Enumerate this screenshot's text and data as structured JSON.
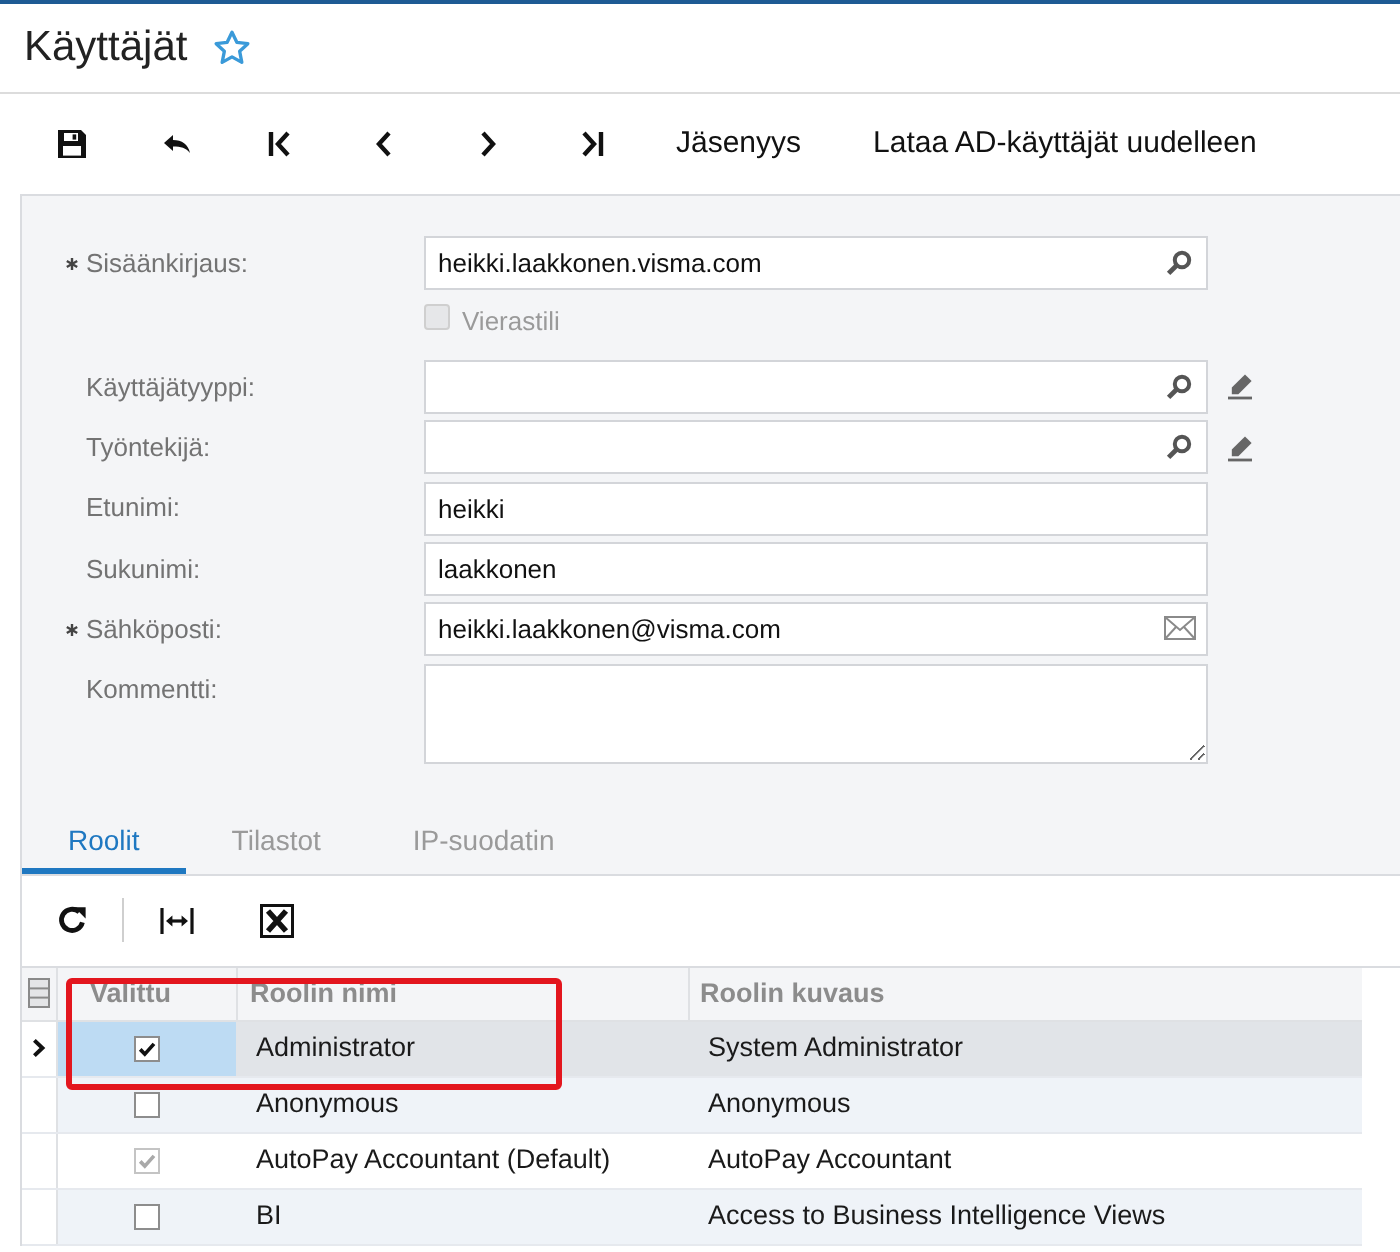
{
  "page": {
    "title": "Käyttäjät",
    "favorite": false
  },
  "toolbar": {
    "text_buttons": [
      "Jäsenyys",
      "Lataa AD-käyttäjät uudelleen"
    ]
  },
  "form": {
    "fields": [
      {
        "kind": "lookup",
        "label": "Sisäänkirjaus:",
        "value": "heikki.laakkonen.visma.com",
        "required": true
      },
      {
        "kind": "checkbox",
        "label": "Vierastili",
        "checked": false,
        "disabled": true
      },
      {
        "kind": "lookup",
        "label": "Käyttäjätyyppi:",
        "required": false,
        "edit_button": true
      },
      {
        "kind": "lookup",
        "label": "Työntekijä:",
        "required": false,
        "edit_button": true
      },
      {
        "kind": "text",
        "label": "Etunimi:",
        "value": "heikki",
        "required": false
      },
      {
        "kind": "text",
        "label": "Sukunimi:",
        "value": "laakkonen",
        "required": false
      },
      {
        "kind": "email",
        "label": "Sähköposti:",
        "value": "heikki.laakkonen@visma.com",
        "required": true
      },
      {
        "kind": "textarea",
        "label": "Kommentti:",
        "required": false
      }
    ]
  },
  "tabs": [
    {
      "label": "Roolit",
      "selected": true
    },
    {
      "label": "Tilastot",
      "selected": false
    },
    {
      "label": "IP-suodatin",
      "selected": false
    }
  ],
  "grid": {
    "columns": [
      "Valittu",
      "Roolin nimi",
      "Roolin kuvaus"
    ],
    "rows": [
      {
        "selected": true,
        "checked": true,
        "disabled": false,
        "name": "Administrator",
        "description": "System Administrator"
      },
      {
        "selected": false,
        "checked": false,
        "disabled": false,
        "name": "Anonymous",
        "description": "Anonymous"
      },
      {
        "selected": false,
        "checked": true,
        "disabled": true,
        "name": "AutoPay Accountant (Default)",
        "description": "AutoPay Accountant"
      },
      {
        "selected": false,
        "checked": false,
        "disabled": false,
        "name": "BI",
        "description": "Access to Business Intelligence Views"
      }
    ]
  },
  "annotation": {
    "kind": "outline"
  }
}
